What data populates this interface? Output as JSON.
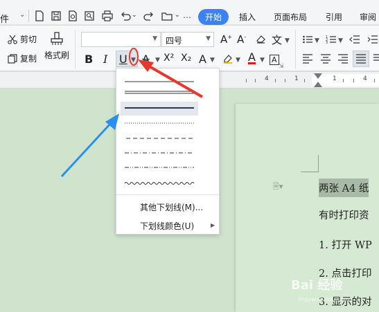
{
  "menubar": {
    "file_label": "件",
    "tabs": [
      "开始",
      "插入",
      "页面布局",
      "引用",
      "审阅"
    ],
    "active_tab": "开始"
  },
  "ribbon": {
    "cut_label": "剪切",
    "copy_label": "复制",
    "format_painter_label": "格式刷",
    "font_name": "",
    "font_size": "四号",
    "bold_label": "B",
    "italic_label": "I",
    "underline_label": "U",
    "superscript_label": "X²",
    "subscript_label": "X₂"
  },
  "ruler": {
    "numbers": [
      "4",
      "1",
      "1",
      "4"
    ]
  },
  "underline_menu": {
    "styles": [
      "single",
      "double",
      "thick",
      "dotted",
      "dashed",
      "dash-dot",
      "dash-dot-dot",
      "wave"
    ],
    "selected_style": "thick",
    "more_label": "其他下划线(M)...",
    "color_label": "下划线颜色(U)"
  },
  "document": {
    "lines": [
      "两张 A4 纸",
      "有时打印资",
      "1. 打开 WP",
      "2. 点击打印",
      "3. 显示的对"
    ]
  },
  "watermark": {
    "text": "Bai 经验",
    "sub": "jingyan.baidu.com"
  },
  "colors": {
    "accent": "#3a82f6",
    "red_arrow": "#e8382e",
    "blue_arrow": "#2a8ff0",
    "page_bg": "#cfe3cd"
  }
}
